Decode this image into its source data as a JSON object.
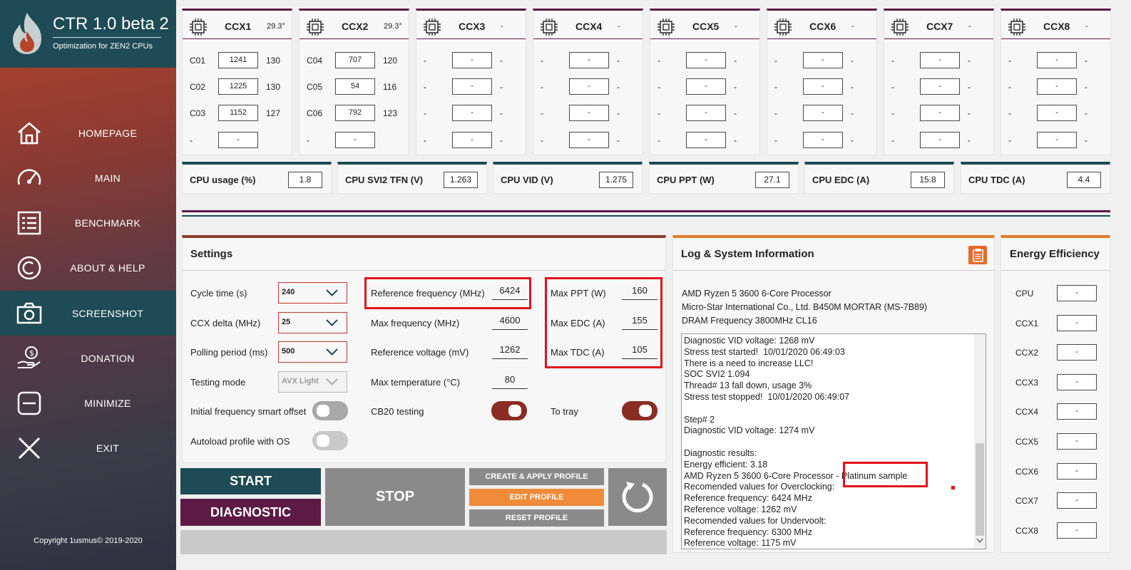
{
  "app": {
    "title": "CTR 1.0 beta 2",
    "subtitle": "Optimization for ZEN2 CPUs",
    "copyright": "Copyright 1usmus© 2019-2020"
  },
  "nav": [
    {
      "label": "HOMEPAGE",
      "icon": "home-icon"
    },
    {
      "label": "MAIN",
      "icon": "speedometer-icon"
    },
    {
      "label": "BENCHMARK",
      "icon": "list-icon"
    },
    {
      "label": "ABOUT & HELP",
      "icon": "copyright-icon"
    },
    {
      "label": "SCREENSHOT",
      "icon": "camera-icon"
    },
    {
      "label": "DONATION",
      "icon": "donation-icon"
    },
    {
      "label": "MINIMIZE",
      "icon": "minimize-icon"
    },
    {
      "label": "EXIT",
      "icon": "exit-icon"
    }
  ],
  "active_nav": "SCREENSHOT",
  "ccx": [
    {
      "name": "CCX1",
      "temp": "29.3°",
      "cores": [
        {
          "id": "C01",
          "freq": "1241",
          "val": "130"
        },
        {
          "id": "C02",
          "freq": "1225",
          "val": "130"
        },
        {
          "id": "C03",
          "freq": "1152",
          "val": "127"
        },
        {
          "id": "-",
          "freq": "-",
          "val": ""
        }
      ]
    },
    {
      "name": "CCX2",
      "temp": "29.3°",
      "cores": [
        {
          "id": "C04",
          "freq": "707",
          "val": "120"
        },
        {
          "id": "C05",
          "freq": "54",
          "val": "116"
        },
        {
          "id": "C06",
          "freq": "792",
          "val": "123"
        },
        {
          "id": "-",
          "freq": "-",
          "val": ""
        }
      ]
    },
    {
      "name": "CCX3",
      "temp": "-",
      "cores": [
        {
          "id": "-",
          "freq": "-",
          "val": "-"
        },
        {
          "id": "-",
          "freq": "-",
          "val": "-"
        },
        {
          "id": "-",
          "freq": "-",
          "val": "-"
        },
        {
          "id": "-",
          "freq": "-",
          "val": "-"
        }
      ]
    },
    {
      "name": "CCX4",
      "temp": "-",
      "cores": [
        {
          "id": "-",
          "freq": "-",
          "val": "-"
        },
        {
          "id": "-",
          "freq": "-",
          "val": "-"
        },
        {
          "id": "-",
          "freq": "-",
          "val": "-"
        },
        {
          "id": "-",
          "freq": "-",
          "val": "-"
        }
      ]
    },
    {
      "name": "CCX5",
      "temp": "-",
      "cores": [
        {
          "id": "-",
          "freq": "-",
          "val": "-"
        },
        {
          "id": "-",
          "freq": "-",
          "val": "-"
        },
        {
          "id": "-",
          "freq": "-",
          "val": "-"
        },
        {
          "id": "-",
          "freq": "-",
          "val": "-"
        }
      ]
    },
    {
      "name": "CCX6",
      "temp": "-",
      "cores": [
        {
          "id": "-",
          "freq": "-",
          "val": "-"
        },
        {
          "id": "-",
          "freq": "-",
          "val": "-"
        },
        {
          "id": "-",
          "freq": "-",
          "val": "-"
        },
        {
          "id": "-",
          "freq": "-",
          "val": "-"
        }
      ]
    },
    {
      "name": "CCX7",
      "temp": "-",
      "cores": [
        {
          "id": "-",
          "freq": "-",
          "val": "-"
        },
        {
          "id": "-",
          "freq": "-",
          "val": "-"
        },
        {
          "id": "-",
          "freq": "-",
          "val": "-"
        },
        {
          "id": "-",
          "freq": "-",
          "val": "-"
        }
      ]
    },
    {
      "name": "CCX8",
      "temp": "-",
      "cores": [
        {
          "id": "-",
          "freq": "-",
          "val": "-"
        },
        {
          "id": "-",
          "freq": "-",
          "val": "-"
        },
        {
          "id": "-",
          "freq": "-",
          "val": "-"
        },
        {
          "id": "-",
          "freq": "-",
          "val": "-"
        }
      ]
    }
  ],
  "stats": [
    {
      "label": "CPU usage (%)",
      "value": "1.8"
    },
    {
      "label": "CPU SVI2 TFN (V)",
      "value": "1.263"
    },
    {
      "label": "CPU VID (V)",
      "value": "1.275"
    },
    {
      "label": "CPU PPT (W)",
      "value": "27.1"
    },
    {
      "label": "CPU EDC (A)",
      "value": "15.8"
    },
    {
      "label": "CPU TDC (A)",
      "value": "4.4"
    }
  ],
  "settings": {
    "title": "Settings",
    "cycle_time_label": "Cycle time (s)",
    "cycle_time": "240",
    "ccx_delta_label": "CCX delta (MHz)",
    "ccx_delta": "25",
    "polling_label": "Polling period (ms)",
    "polling": "500",
    "testing_mode_label": "Testing mode",
    "testing_mode": "AVX Light",
    "smart_offset_label": "Initial frequency smart offset",
    "autoload_label": "Autoload profile with OS",
    "ref_freq_label": "Reference frequency (MHz)",
    "ref_freq": "6424",
    "max_freq_label": "Max frequency (MHz)",
    "max_freq": "4600",
    "ref_volt_label": "Reference voltage (mV)",
    "ref_volt": "1262",
    "max_temp_label": "Max temperature (°C)",
    "max_temp": "80",
    "cb20_label": "CB20 testing",
    "max_ppt_label": "Max PPT (W)",
    "max_ppt": "160",
    "max_edc_label": "Max EDC (A)",
    "max_edc": "155",
    "max_tdc_label": "Max TDC (A)",
    "max_tdc": "105",
    "tray_label": "To tray",
    "toggles": {
      "smart_offset": "off",
      "autoload": "off",
      "cb20": "on",
      "tray": "on"
    }
  },
  "buttons": {
    "start": "START",
    "diagnostic": "DIAGNOSTIC",
    "stop": "STOP",
    "create_apply": "CREATE & APPLY PROFILE",
    "edit": "EDIT PROFILE",
    "reset": "RESET PROFILE"
  },
  "log": {
    "title": "Log & System Information",
    "cpu": "AMD Ryzen 5 3600 6-Core Processor",
    "board": "Micro-Star International Co., Ltd. B450M MORTAR (MS-7B89)",
    "dram": "DRAM Frequency 3800MHz CL16",
    "lines": [
      "Diagnostic VID voltage: 1268 mV",
      "Stress test started!  10/01/2020 06:49:03",
      "There is a need to increase LLC!",
      "SOC SVI2 1.094",
      "Thread# 13 fall down, usage 3%",
      "Stress test stopped!  10/01/2020 06:49:07",
      "",
      "Step# 2",
      "Diagnostic VID voltage: 1274 mV",
      "",
      "Diagnostic results:",
      "Energy efficient: 3.18",
      "AMD Ryzen 5 3600 6-Core Processor - Platinum sample",
      "Recomended values for Overclocking:",
      "Reference frequency: 6424 MHz",
      "Reference voltage: 1262 mV",
      "Recomended values for Undervoolt:",
      "Reference frequency: 6300 MHz",
      "Reference voltage: 1175 mV"
    ]
  },
  "energy": {
    "title": "Energy Efficiency",
    "rows": [
      {
        "label": "CPU",
        "value": "-"
      },
      {
        "label": "CCX1",
        "value": "-"
      },
      {
        "label": "CCX2",
        "value": "-"
      },
      {
        "label": "CCX3",
        "value": "-"
      },
      {
        "label": "CCX4",
        "value": "-"
      },
      {
        "label": "CCX5",
        "value": "-"
      },
      {
        "label": "CCX6",
        "value": "-"
      },
      {
        "label": "CCX7",
        "value": "-"
      },
      {
        "label": "CCX8",
        "value": "-"
      }
    ]
  },
  "colors": {
    "teal": "#1e4b55",
    "plum": "#5d1a45",
    "rust": "#8b2c22",
    "orange": "#f08b39",
    "highlight": "#e3101b"
  }
}
